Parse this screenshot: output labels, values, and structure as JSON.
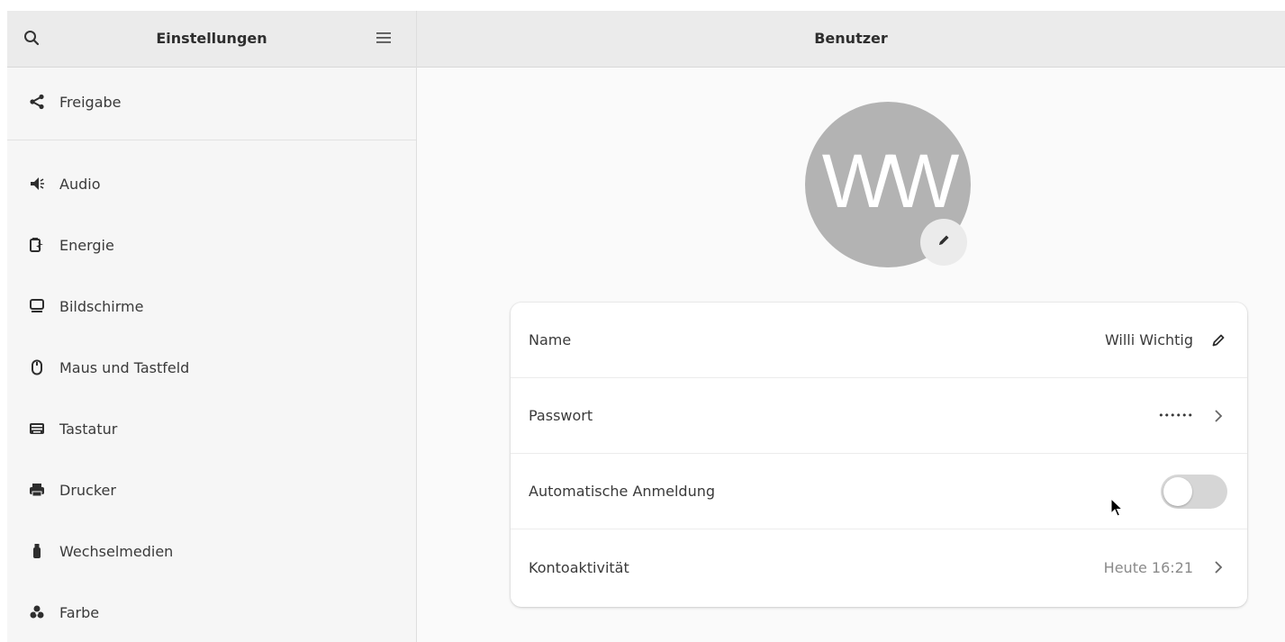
{
  "sidebar": {
    "title": "Einstellungen",
    "search_icon": "search-icon",
    "menu_icon": "hamburger-menu-icon",
    "items": [
      {
        "label": "Freigabe",
        "icon": "share-icon"
      },
      {
        "label": "Audio",
        "icon": "speaker-icon"
      },
      {
        "label": "Energie",
        "icon": "battery-icon"
      },
      {
        "label": "Bildschirme",
        "icon": "display-icon"
      },
      {
        "label": "Maus und Tastfeld",
        "icon": "mouse-icon"
      },
      {
        "label": "Tastatur",
        "icon": "keyboard-icon"
      },
      {
        "label": "Drucker",
        "icon": "printer-icon"
      },
      {
        "label": "Wechselmedien",
        "icon": "usb-drive-icon"
      },
      {
        "label": "Farbe",
        "icon": "color-icon"
      }
    ]
  },
  "main": {
    "title": "Benutzer",
    "avatar": {
      "initials": "WW",
      "color": "#b3b3b3",
      "edit_icon": "pencil-icon"
    },
    "rows": [
      {
        "label": "Name",
        "value": "Willi Wichtig",
        "trail_icon": "pencil-icon"
      },
      {
        "label": "Passwort",
        "value": "••••••",
        "trail_icon": "chevron-right-icon"
      },
      {
        "label": "Automatische Anmeldung",
        "toggle": false
      },
      {
        "label": "Kontoaktivität",
        "value": "Heute 16:21",
        "trail_icon": "chevron-right-icon"
      }
    ]
  },
  "colors": {
    "header_bg": "#ebebeb",
    "sidebar_bg": "#f6f6f6",
    "card_bg": "#ffffff",
    "switch_off": "#d6d6d6"
  }
}
